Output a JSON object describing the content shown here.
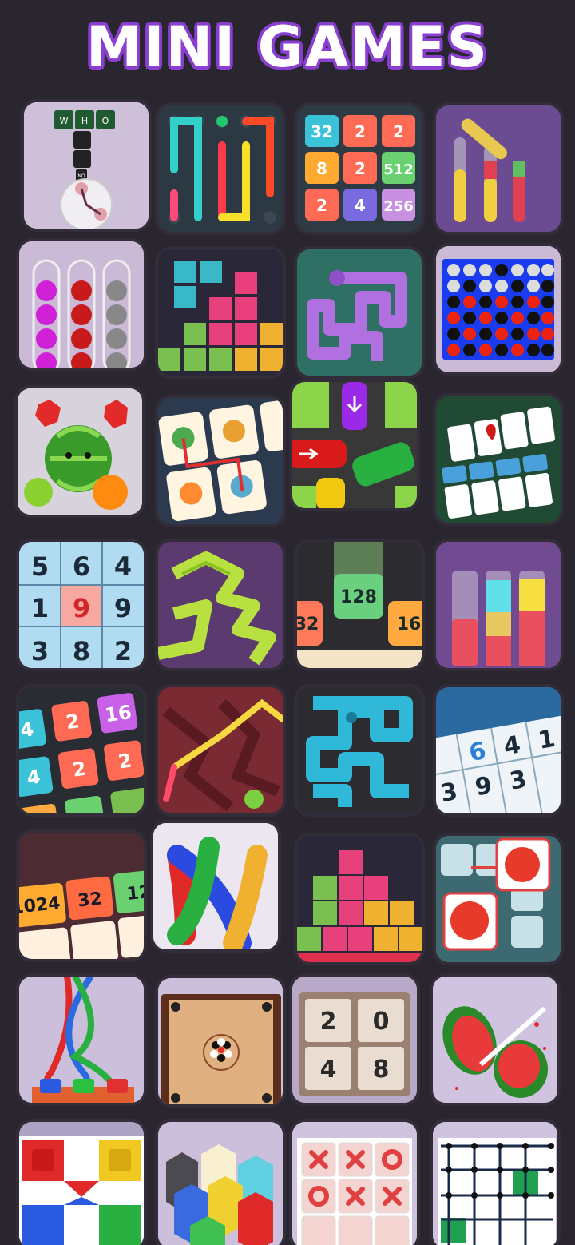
{
  "header": {
    "title": "MINI GAMES"
  },
  "colors": {
    "background": "#2a2630",
    "title_fill": "#ffffff",
    "title_outline": "#8a3fd0",
    "tile_frame": "#332d3a"
  },
  "tiles": [
    {
      "name": "word-clock-game",
      "words": [
        "W",
        "H",
        "O"
      ],
      "tag": "NO",
      "icon": "clock"
    },
    {
      "name": "dot-connect-game",
      "icon": "pipes"
    },
    {
      "name": "merge-2048-grid-game",
      "nums": [
        "32",
        "2",
        "2",
        "8",
        "2",
        "512",
        "2",
        "4",
        "256"
      ]
    },
    {
      "name": "liquid-sort-pour-game",
      "icon": "tubes-pour"
    },
    {
      "name": "ball-sort-game",
      "icon": "ball-tubes"
    },
    {
      "name": "block-stack-game",
      "icon": "blocks"
    },
    {
      "name": "pipe-path-purple-game",
      "icon": "pipe-maze"
    },
    {
      "name": "connect-four-game",
      "icon": "connect-four"
    },
    {
      "name": "fruit-merge-game",
      "icon": "fruits"
    },
    {
      "name": "onet-match-game",
      "icon": "animal-tiles"
    },
    {
      "name": "car-parking-jam-game",
      "icon": "cars"
    },
    {
      "name": "solitaire-game",
      "icon": "cards"
    },
    {
      "name": "number-sudoku-game",
      "nums": [
        "5",
        "6",
        "4",
        "1",
        "9",
        "9",
        "3",
        "8",
        "2"
      ]
    },
    {
      "name": "snake-maze-game",
      "icon": "snake-path"
    },
    {
      "name": "drop-number-game",
      "nums": [
        "32",
        "128",
        "16"
      ]
    },
    {
      "name": "water-sort-game",
      "icon": "tubes"
    },
    {
      "name": "merge-chain-game",
      "nums": [
        "4",
        "2",
        "16",
        "4",
        "2",
        "2"
      ]
    },
    {
      "name": "line-draw-game",
      "icon": "line"
    },
    {
      "name": "pipe-path-blue-game",
      "icon": "pipe-maze-blue"
    },
    {
      "name": "sudoku-game",
      "nums": [
        "6",
        "4",
        "1",
        "3",
        "9",
        "3"
      ]
    },
    {
      "name": "merge-2048-tiles-game",
      "nums": [
        "1024",
        "32",
        "12"
      ]
    },
    {
      "name": "twisted-ropes-game",
      "icon": "ropes"
    },
    {
      "name": "block-puzzle-game",
      "icon": "blocks-2"
    },
    {
      "name": "parrot-match-game",
      "icon": "parrots"
    },
    {
      "name": "rope-untangle-game",
      "icon": "ropes-2"
    },
    {
      "name": "carrom-game",
      "icon": "carrom"
    },
    {
      "name": "2048-classic-game",
      "nums": [
        "2",
        "0",
        "4",
        "8"
      ]
    },
    {
      "name": "fruit-slice-game",
      "icon": "watermelon"
    },
    {
      "name": "ludo-game",
      "icon": "ludo"
    },
    {
      "name": "hexa-sort-game",
      "icon": "hexa"
    },
    {
      "name": "tic-tac-toe-game",
      "icon": "xo"
    },
    {
      "name": "dots-boxes-game",
      "icon": "dots"
    }
  ]
}
